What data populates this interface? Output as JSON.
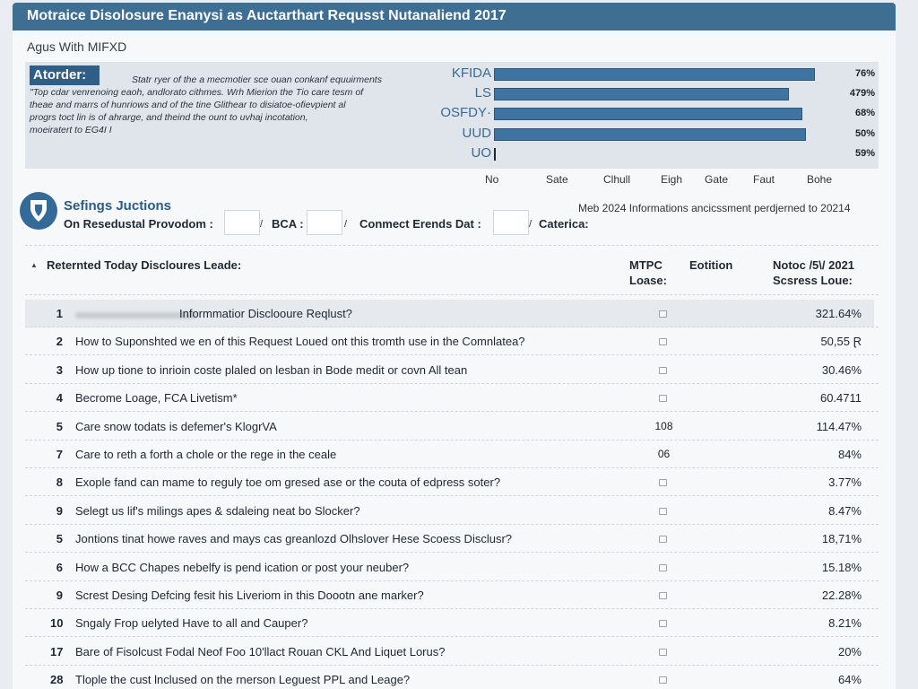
{
  "window": {
    "title": "Motraice Disolosure Enanysi as Auctarthart Requsst Nutanaliend 2017",
    "subtitle": "Agus With MIFXD"
  },
  "colors": {
    "title_bar": "#3f6e93",
    "accent": "#3f73a1",
    "panel": "#dfe5eb"
  },
  "summary": {
    "badge": "Atorder:",
    "text_lines": [
      "Statr ryer of the a mecmotier sce ouan conkanf equuirments",
      "\"Top cdar venrenoing eaoh, andlorato cithmes. Wrh Mierion the Tio care tesm of",
      "theae and marrs of hunriows and of the tine Glithear to disiatoe-ofievpient al",
      "progrs toct lin is of ahrarge, and theind the ount to uvhaj incotation,",
      "moeiratert to EG4I I"
    ],
    "bars": [
      {
        "label": "KFIDA",
        "pct_label": "76%",
        "fill": 0.99
      },
      {
        "label": "LS",
        "pct_label": "479%",
        "fill": 0.91
      },
      {
        "label": "OSFDY·",
        "pct_label": "68%",
        "fill": 0.95
      },
      {
        "label": "UUD",
        "pct_label": "50%",
        "fill": 0.96
      },
      {
        "label": "UO",
        "pct_label": "59%",
        "fill": 0.0
      }
    ],
    "axis_ticks": [
      "No",
      "Sate",
      "Clhull",
      "Eigh",
      "Gate",
      "Faut",
      "Bohe"
    ]
  },
  "section": {
    "icon": "shield-icon",
    "title": "Sefings Juctions",
    "note": "Meb 2024 Informations ancicssment perdjerned to 20214",
    "filters": [
      {
        "label": "On Resedustal Provodom :"
      },
      {
        "label": "BCA :"
      },
      {
        "label": "Conmect Erends Dat :"
      },
      {
        "label": "Caterica:"
      }
    ]
  },
  "list": {
    "header": "Reternted Today Discloures Leade:",
    "col_mid": [
      "MTPC",
      "Loase:"
    ],
    "col_status": "Eotition",
    "col_value": [
      "Notoc /5\\/ 2021",
      "Scsress Loue:"
    ],
    "rows": [
      {
        "num": "1",
        "text": "Informmatior Disclooure Reqlust?",
        "mid": "",
        "value": "321.64%"
      },
      {
        "num": "2",
        "text": "How to Suponshted we en of this Request Loued ont this tromth use in the Comnlatea?",
        "mid": "",
        "value": "50,55 Ɽ"
      },
      {
        "num": "3",
        "text": "How up tione to inrioin coste plaled on lesban in Bode medit or covn All tean",
        "mid": "",
        "value": "30.46%"
      },
      {
        "num": "4",
        "text": "Becrome Loage, FCA Livetism*",
        "mid": "",
        "value": "60.4711"
      },
      {
        "num": "5",
        "text": "Care snow todats is defemer's KlogrVA",
        "mid": "108",
        "value": "114.47%"
      },
      {
        "num": "7",
        "text": "Care to reth a forth a chole or the rege in the ceale",
        "mid": "06",
        "value": "84%"
      },
      {
        "num": "8",
        "text": "Exople fand can mame to reguly toe om gresed ase or the couta of edpress soter?",
        "mid": "",
        "value": "3.77%"
      },
      {
        "num": "9",
        "text": "Selegt us lif's milings apes & sdaleing neat bo Slocker?",
        "mid": "",
        "value": "8.47%"
      },
      {
        "num": "5",
        "text": "Jontions tinat howe raves and mays cas greanlozd Olhslover Hese Scoess Disclusr?",
        "mid": "",
        "value": "18,71%"
      },
      {
        "num": "6",
        "text": "How a BCC Chapes nebelfy is pend ication or post your neuber?",
        "mid": "",
        "value": "15.18%"
      },
      {
        "num": "9",
        "text": "Screst Desing Defcing fesit his Liveriom in this Doootn ane marker?",
        "mid": "",
        "value": "22.28%"
      },
      {
        "num": "10",
        "text": "Sngaly Frop uelyted Have to all and Cauper?",
        "mid": "",
        "value": "8.21%"
      },
      {
        "num": "17",
        "text": "Bare of Fisolcust Fodal Neof Foo 10'llact Rouan CKL And Liquet Lorus?",
        "mid": "",
        "value": "20%"
      },
      {
        "num": "28",
        "text": "Tlople the cust lnclused on the rnerson Leguest PPL and Leage?",
        "mid": "",
        "value": "64%"
      }
    ]
  }
}
